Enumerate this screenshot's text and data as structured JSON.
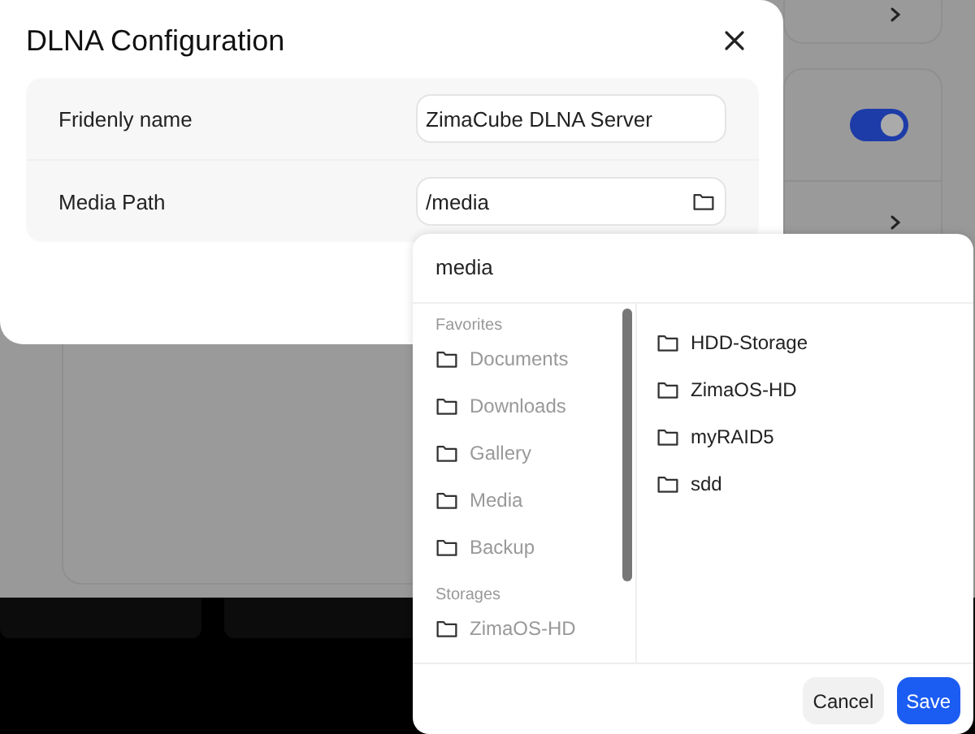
{
  "background": {
    "toggle": {
      "on": true
    }
  },
  "dialog": {
    "title": "DLNA Configuration",
    "fields": [
      {
        "label": "Fridenly name",
        "value": "ZimaCube DLNA Server",
        "kind": "text"
      },
      {
        "label": "Media Path",
        "value": "/media",
        "kind": "folder"
      }
    ]
  },
  "picker": {
    "path": "media",
    "sections": [
      {
        "heading": "Favorites",
        "items": [
          "Documents",
          "Downloads",
          "Gallery",
          "Media",
          "Backup"
        ]
      },
      {
        "heading": "Storages",
        "items": [
          "ZimaOS-HD"
        ]
      }
    ],
    "folders": [
      "HDD-Storage",
      "ZimaOS-HD",
      "myRAID5",
      "sdd"
    ],
    "buttons": [
      {
        "label": "Cancel",
        "kind": "secondary"
      },
      {
        "label": "Save",
        "kind": "primary"
      }
    ]
  }
}
